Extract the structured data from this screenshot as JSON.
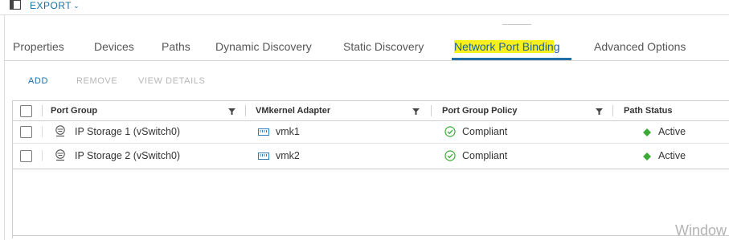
{
  "toolbar": {
    "export_label": "EXPORT",
    "export_caret": "⌄",
    "columns_icon": "columns-icon"
  },
  "tabs": [
    {
      "label": "Properties"
    },
    {
      "label": "Devices"
    },
    {
      "label": "Paths"
    },
    {
      "label": "Dynamic Discovery"
    },
    {
      "label": "Static Discovery"
    },
    {
      "label": "Network Port Binding",
      "active": true,
      "highlighted_part": "Network Port Bindin",
      "rest": "g"
    },
    {
      "label": "Advanced Options"
    }
  ],
  "actions": {
    "add": "ADD",
    "remove": "REMOVE",
    "view_details": "VIEW DETAILS"
  },
  "grid": {
    "columns": [
      "Port Group",
      "VMkernel Adapter",
      "Port Group Policy",
      "Path Status"
    ],
    "rows": [
      {
        "port_group": "IP Storage 1 (vSwitch0)",
        "adapter": "vmk1",
        "policy": "Compliant",
        "status": "Active"
      },
      {
        "port_group": "IP Storage 2 (vSwitch0)",
        "adapter": "vmk2",
        "policy": "Compliant",
        "status": "Active"
      }
    ]
  },
  "watermark": "Window",
  "colors": {
    "accent": "#1a6ea8",
    "highlight": "#f7f01e",
    "active_status": "#3aaa35",
    "compliant": "#3aaa35"
  }
}
